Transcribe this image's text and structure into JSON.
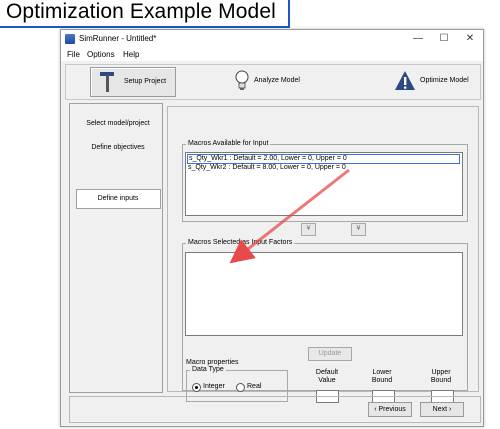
{
  "banner": {
    "title": "Optimization Example Model"
  },
  "window": {
    "title": "SimRunner - Untitled*",
    "minimize": "—",
    "maximize": "☐",
    "close": "✕"
  },
  "menu": {
    "items": [
      "File",
      "Options",
      "Help"
    ]
  },
  "toolbar": {
    "setup_label": "Setup Project",
    "analyze_label": "Analyze Model",
    "optimize_label": "Optimize Model"
  },
  "sidebar": {
    "items": [
      "Select model/project",
      "Define objectives",
      "Define inputs"
    ],
    "active_index": 2
  },
  "macros_available": {
    "title": "Macros Available for Input",
    "items": [
      "s_Qty_Wkr1 : Default = 2.00, Lower = 0, Upper = 0",
      "s_Qty_Wkr2 : Default = 8.00, Lower = 0, Upper = 0"
    ]
  },
  "move_buttons": {
    "down": "¥",
    "up": "¥"
  },
  "macros_selected": {
    "title": "Macros Selected as Input Factors"
  },
  "update_button": "Update",
  "macro_properties": {
    "title": "Macro properties",
    "data_type": {
      "title": "Data Type",
      "integer": "Integer",
      "real": "Real",
      "selected": "Integer"
    },
    "default_label": "Default Value",
    "lower_label": "Lower Bound",
    "upper_label": "Upper Bound"
  },
  "nav": {
    "previous": "‹ Previous",
    "next": "Next ›"
  },
  "colors": {
    "accent": "#1e56c8",
    "arrow": "#e84a4a"
  }
}
